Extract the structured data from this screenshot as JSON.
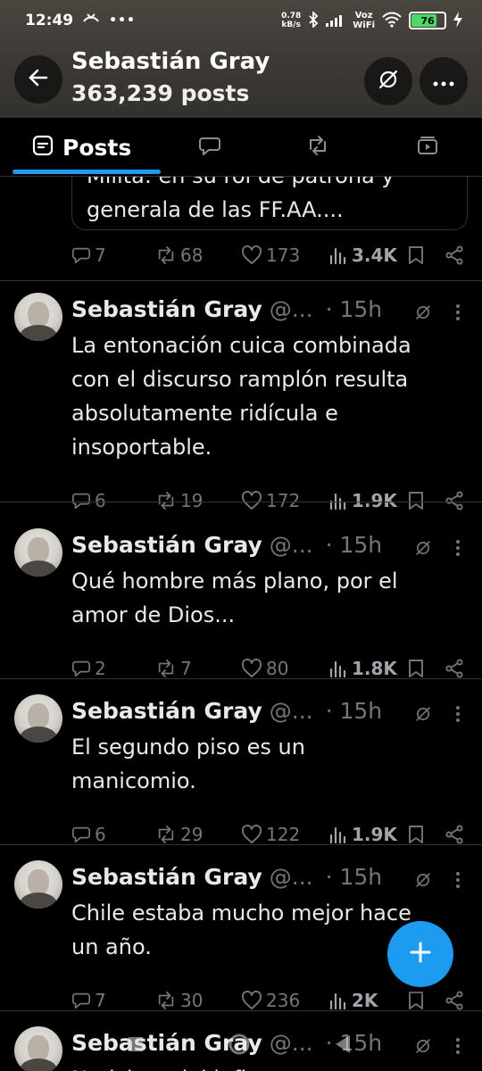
{
  "status_bar": {
    "time": "12:49",
    "net_speed_value": "0.78",
    "net_speed_unit": "kB/s",
    "voz": "Voz",
    "wifi_label": "WiFi",
    "battery": "76",
    "icons": [
      "missed-call-icon",
      "more-dots-icon",
      "bluetooth-icon",
      "signal-icon",
      "wifi-icon",
      "battery-icon",
      "charging-icon"
    ]
  },
  "header": {
    "name": "Sebastián Gray",
    "post_count": "363,239 posts",
    "icons": [
      "back-arrow-icon",
      "grok-icon",
      "more-icon"
    ]
  },
  "tabs": [
    {
      "label": "Posts",
      "icon": "posts-icon",
      "active": true
    },
    {
      "label": "",
      "icon": "replies-icon"
    },
    {
      "label": "",
      "icon": "reposts-icon"
    },
    {
      "label": "",
      "icon": "media-icon"
    }
  ],
  "top_card": {
    "lines": [
      "Milita: en su rol de patrona y",
      "generala de las FF.AA...."
    ],
    "reply": "7",
    "repost": "68",
    "like": "173",
    "views": "3.4K"
  },
  "tweets": [
    {
      "name": "Sebastián Gray",
      "handle": "@...",
      "time": "· 15h",
      "text": "La entonación cuica combinada\ncon el discurso ramplón resulta\nabsolutamente ridícula e\ninsoportable.",
      "reply": "6",
      "repost": "19",
      "like": "172",
      "views": "1.9K"
    },
    {
      "name": "Sebastián Gray",
      "handle": "@...",
      "time": "· 15h",
      "text": "Qué hombre más plano, por el\namor de Dios...",
      "reply": "2",
      "repost": "7",
      "like": "80",
      "views": "1.8K"
    },
    {
      "name": "Sebastián Gray",
      "handle": "@...",
      "time": "· 15h",
      "text": "El segundo piso es un\nmanicomio.",
      "reply": "6",
      "repost": "29",
      "like": "122",
      "views": "1.9K"
    },
    {
      "name": "Sebastián Gray",
      "handle": "@...",
      "time": "· 15h",
      "text": "Chile estaba mucho mejor hace\nun año.",
      "reply": "7",
      "repost": "30",
      "like": "236",
      "views": "2K"
    },
    {
      "name": "Sebastián Gray",
      "handle": "@...",
      "time": "· 15h",
      "text": "Noticiero del infierno...",
      "reply": "",
      "repost": "",
      "like": "",
      "views": ""
    }
  ],
  "colors": {
    "accent": "#1d9bf0",
    "background": "#000000",
    "muted": "#71767b",
    "text": "#e7e9ea"
  }
}
